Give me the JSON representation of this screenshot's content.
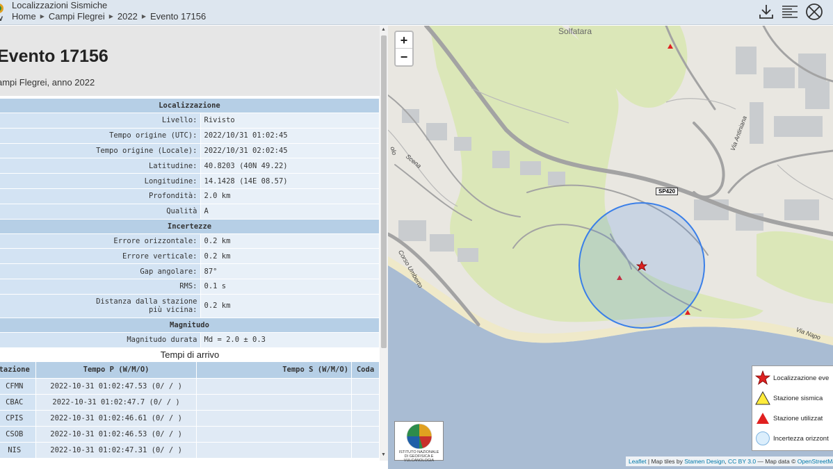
{
  "header": {
    "app_title": "Localizzazioni Sismiche",
    "breadcrumb": [
      "Home",
      "Campi Flegrei",
      "2022",
      "Evento 17156"
    ],
    "logo_text": "V",
    "icons": [
      "download-icon",
      "list-icon",
      "no-entry-icon"
    ]
  },
  "event": {
    "title": "Evento 17156",
    "subtitle": "ampi Flegrei, anno 2022"
  },
  "info_table": {
    "section_localizzazione": "Localizzazione",
    "rows_localizzazione": [
      {
        "k": "Livello:",
        "v": "Rivisto"
      },
      {
        "k": "Tempo origine (UTC):",
        "v": "2022/10/31 01:02:45"
      },
      {
        "k": "Tempo origine (Locale):",
        "v": "2022/10/31 02:02:45"
      },
      {
        "k": "Latitudine:",
        "v": "40.8203 (40N 49.22)"
      },
      {
        "k": "Longitudine:",
        "v": "14.1428 (14E 08.57)"
      },
      {
        "k": "Profondità:",
        "v": "2.0 km"
      },
      {
        "k": "Qualità",
        "v": "A"
      }
    ],
    "section_incertezze": "Incertezze",
    "rows_incertezze": [
      {
        "k": "Errore orizzontale:",
        "v": "0.2 km"
      },
      {
        "k": "Errore verticale:",
        "v": "0.2 km"
      },
      {
        "k": "Gap angolare:",
        "v": "87°"
      },
      {
        "k": "RMS:",
        "v": "0.1 s"
      },
      {
        "k1": "Distanza dalla stazione",
        "k2": "più vicina:",
        "v": "0.2 km"
      }
    ],
    "section_magnitudo": "Magnitudo",
    "rows_magnitudo": [
      {
        "k": "Magnitudo durata",
        "v": "Md = 2.0 ± 0.3"
      }
    ]
  },
  "arrivals": {
    "title": "Tempi di arrivo",
    "columns": [
      "tazione",
      "Tempo P (W/M/O)",
      "Tempo S (W/M/O)",
      "Coda"
    ],
    "rows": [
      {
        "station": "CFMN",
        "p": "2022-10-31 01:02:47.53 (0/ / )",
        "s": "",
        "coda": ""
      },
      {
        "station": "CBAC",
        "p": "2022-10-31 01:02:47.7 (0/ / )",
        "s": "",
        "coda": ""
      },
      {
        "station": "CPIS",
        "p": "2022-10-31 01:02:46.61 (0/ / )",
        "s": "",
        "coda": ""
      },
      {
        "station": "CSOB",
        "p": "2022-10-31 01:02:46.53 (0/ / )",
        "s": "",
        "coda": ""
      },
      {
        "station": "NIS",
        "p": "2022-10-31 01:02:47.31 (0/ / )",
        "s": "",
        "coda": ""
      }
    ]
  },
  "map": {
    "zoom_in": "+",
    "zoom_out": "−",
    "place_label": "Solfatara",
    "road_badge": "SP420",
    "street_labels": [
      "Via Antiniana",
      "Corso Umberto",
      "Scena",
      "olo",
      "Via Napo"
    ],
    "legend": [
      {
        "icon": "red-star-icon",
        "label": "Localizzazione eve"
      },
      {
        "icon": "yellow-triangle-icon",
        "label": "Stazione sismica"
      },
      {
        "icon": "red-triangle-icon",
        "label": "Stazione utilizzat"
      },
      {
        "icon": "circle-icon",
        "label": "Incertezza orizzont"
      }
    ],
    "ingv_label": "ISTITUTO NAZIONALE DI GEOFISICA E VULCANOLOGIA",
    "attribution": {
      "leaflet": "Leaflet",
      "sep1": " | Map tiles by ",
      "stamen": "Stamen Design",
      "sep2": ", ",
      "cc": "CC BY 3.0",
      "sep3": " — Map data © ",
      "osm": "OpenStreetMap"
    },
    "colors": {
      "land": "#e9e7e1",
      "park": "#dbe7b8",
      "sea": "#a9bcd3",
      "road": "#a3a3a3",
      "building": "#c9cccf",
      "uncertainty": "#3a7fe8",
      "epicenter": "#dd2222"
    }
  }
}
